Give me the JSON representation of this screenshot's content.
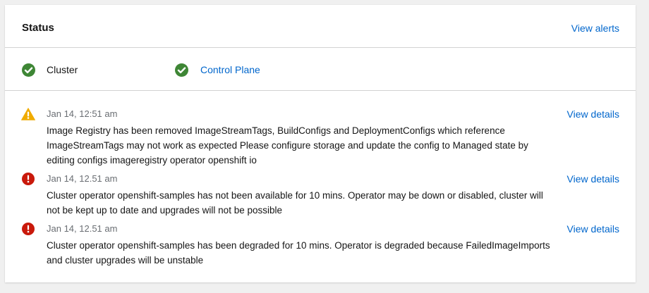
{
  "status_card": {
    "title": "Status",
    "view_alerts_label": "View alerts"
  },
  "health": {
    "items": [
      {
        "label": "Cluster",
        "icon": "check-circle-icon",
        "status": "healthy"
      },
      {
        "label": "Control Plane",
        "icon": "check-circle-icon",
        "status": "healthy"
      }
    ]
  },
  "alerts": [
    {
      "severity": "warning",
      "icon": "warning-triangle-icon",
      "time": "Jan 14, 12:51 am",
      "message": "Image Registry has been removed  ImageStreamTags, BuildConfigs and DeploymentConfigs which reference ImageStreamTags may not work as expected  Please configure storage and update the config to Managed state by editing configs imageregistry operator openshift io",
      "link_label": "View details"
    },
    {
      "severity": "critical",
      "icon": "exclamation-circle-icon",
      "time": "Jan 14, 12.51 am",
      "message": "Cluster operator openshift-samples has not been available for 10 mins. Operator may be down or disabled, cluster will not be kept up to date and upgrades will not be possible",
      "link_label": "View details"
    },
    {
      "severity": "critical",
      "icon": "exclamation-circle-icon",
      "time": "Jan 14, 12.51 am",
      "message": "Cluster operator openshift-samples has been degraded for 10 mins. Operator is degraded because FailedImageImports and cluster upgrades will be unstable",
      "link_label": "View details"
    }
  ],
  "colors": {
    "success": "#3e8635",
    "warning": "#f0ab00",
    "danger": "#c9190b",
    "link": "#0066cc"
  }
}
